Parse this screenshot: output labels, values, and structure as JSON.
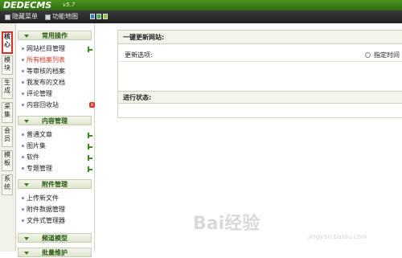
{
  "header": {
    "logo": "DEDECMS",
    "version": "v5.7"
  },
  "toolbar": {
    "hide_menu": "隐藏菜单",
    "function_map": "功能地图",
    "theme_colors": [
      "#2e86c9",
      "#3fae49",
      "#9bc13c"
    ]
  },
  "vtabs": [
    {
      "label": "核心",
      "active": true
    },
    {
      "label": "模块",
      "active": false
    },
    {
      "label": "生成",
      "active": false
    },
    {
      "label": "采集",
      "active": false
    },
    {
      "label": "会员",
      "active": false
    },
    {
      "label": "模板",
      "active": false
    },
    {
      "label": "系统",
      "active": false
    }
  ],
  "menu": {
    "sections": [
      {
        "title": "常用操作",
        "items": [
          "网站栏目管理",
          "所有档案列表",
          "等审核的档案",
          "我发布的文档",
          "评论管理",
          "内容回收站"
        ]
      },
      {
        "title": "内容管理",
        "items": [
          "普通文章",
          "图片集",
          "软件",
          "专题管理"
        ]
      },
      {
        "title": "附件管理",
        "items": [
          "上传新文件",
          "附件数据管理",
          "文件式管理器"
        ]
      },
      {
        "title": "频道模型",
        "items": []
      },
      {
        "title": "批量维护",
        "items": []
      }
    ]
  },
  "main": {
    "panel_title": "一键更新网站:",
    "update_option_label": "更新选项:",
    "update_option_choice": "指定时间",
    "status_label": "进行状态:"
  },
  "watermark": {
    "text": "Bai经验",
    "url": "jingyan.baidu.com"
  }
}
